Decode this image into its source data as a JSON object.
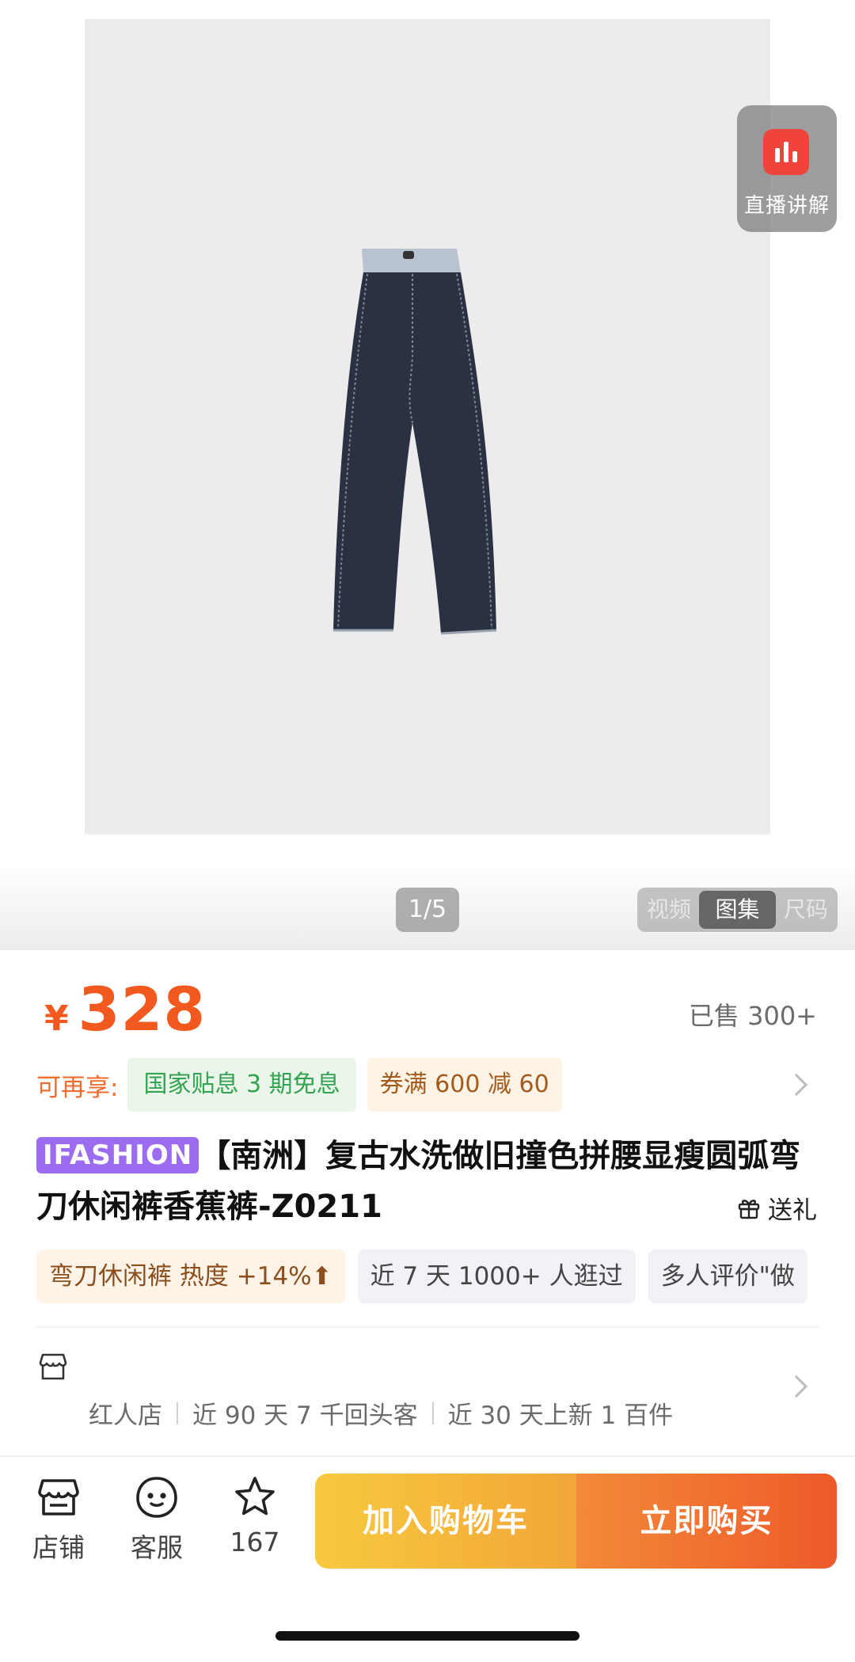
{
  "gallery": {
    "live_label": "直播讲解",
    "counter": "1/5",
    "segments": [
      "视频",
      "图集",
      "尺码"
    ],
    "active_segment": "图集"
  },
  "price": {
    "currency": "¥",
    "amount": "328",
    "sold": "已售 300+"
  },
  "promo": {
    "label": "可再享:",
    "subsidy": "国家贴息 3 期免息",
    "coupon": "券满 600 减 60"
  },
  "product": {
    "brand": "IFASHION",
    "title": "【南洲】复古水洗做旧撞色拼腰显瘦圆弧弯刀休闲裤香蕉裤-Z0211",
    "gift": "送礼"
  },
  "chips": [
    {
      "text": "弯刀休闲裤 热度 +14%⬆"
    },
    {
      "text": "近 7 天 1000+ 人逛过"
    },
    {
      "text": "多人评价\"做"
    }
  ],
  "store": {
    "meta": [
      "红人店",
      "近 90 天 7 千回头客",
      "近 30 天上新 1 百件"
    ]
  },
  "bottom_bar": {
    "store_label": "店铺",
    "service_label": "客服",
    "favorite_count": "167",
    "add_to_cart": "加入购物车",
    "buy_now": "立即购买"
  },
  "colors": {
    "accent": "#f2591f",
    "brand_tag": "#9b6cf0",
    "cart_button": "#f7c93e",
    "buy_button": "#ee5a2a"
  }
}
